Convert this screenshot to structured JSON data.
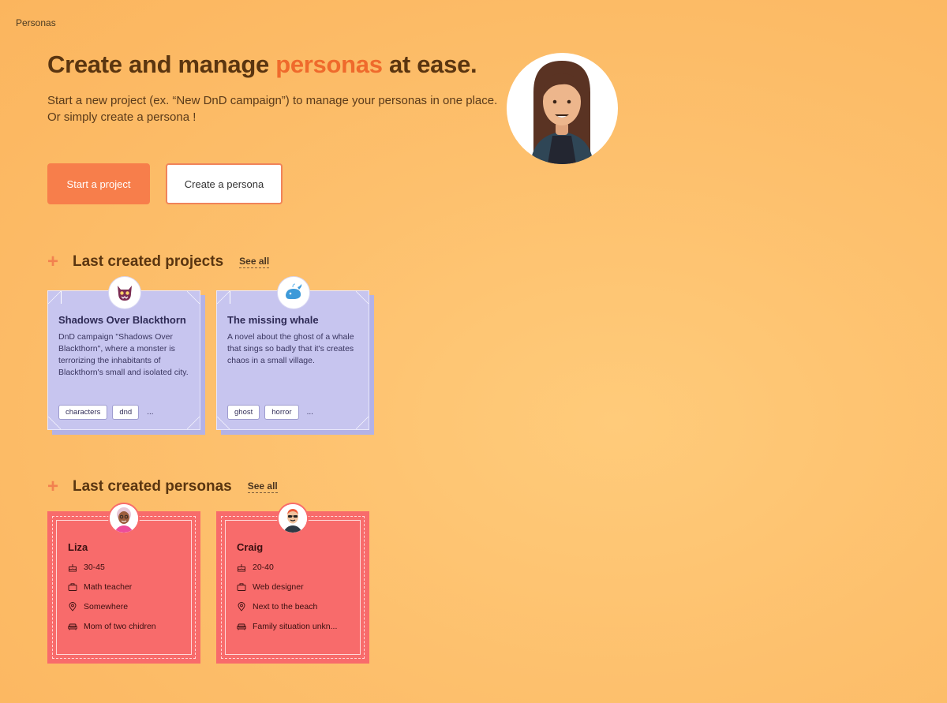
{
  "app": {
    "title": "Personas"
  },
  "hero": {
    "title_pre": "Create and manage ",
    "title_accent": "personas",
    "title_post": " at ease.",
    "subtitle": "Start a new project (ex. “New DnD campaign”) to manage your personas in one place. Or simply create a persona !",
    "start_project_label": "Start a project",
    "create_persona_label": "Create a persona"
  },
  "projects_section": {
    "title": "Last created projects",
    "see_all": "See all"
  },
  "projects": [
    {
      "icon": "devil-mask-icon",
      "title": "Shadows Over Blackthorn",
      "description": "DnD campaign \"Shadows Over Blackthorn\", where a monster is terrorizing the inhabitants of Blackthorn's small and isolated city.",
      "tags": [
        "characters",
        "dnd"
      ],
      "more": "..."
    },
    {
      "icon": "whale-icon",
      "title": "The missing whale",
      "description": "A novel about the ghost of a whale that sings so badly that it's creates chaos in a small village.",
      "tags": [
        "ghost",
        "horror"
      ],
      "more": "..."
    }
  ],
  "personas_section": {
    "title": "Last created personas",
    "see_all": "See all"
  },
  "personas": [
    {
      "name": "Liza",
      "age": "30-45",
      "job": "Math teacher",
      "location": "Somewhere",
      "family": "Mom of two chidren"
    },
    {
      "name": "Craig",
      "age": "20-40",
      "job": "Web designer",
      "location": "Next to the beach",
      "family": "Family situation unkn..."
    }
  ],
  "colors": {
    "accent": "#ef6a2c",
    "primary_button": "#f77e4b",
    "project_card": "#c7c5ef",
    "persona_card": "#f86b6b"
  }
}
